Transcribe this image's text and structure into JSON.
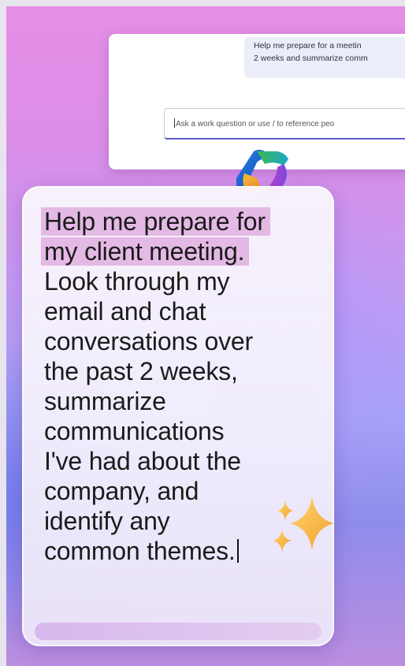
{
  "chat": {
    "user_message_line1": "Help me prepare for a meetin",
    "user_message_line2": "2 weeks and summarize comm",
    "input_placeholder": "Ask a work question or use / to reference peo"
  },
  "prompt": {
    "highlighted_lines": [
      "Help me prepare for",
      "my client meeting."
    ],
    "lines": [
      "Look through my",
      "email and chat",
      "conversations over",
      "the past 2 weeks,",
      "summarize",
      "communications",
      "I've had about the",
      "company, and",
      "identify any",
      "common themes."
    ]
  },
  "icons": {
    "logo": "copilot-logo-icon",
    "sparkle": "sparkle-icon",
    "sparkle_color": "#f5b642"
  }
}
